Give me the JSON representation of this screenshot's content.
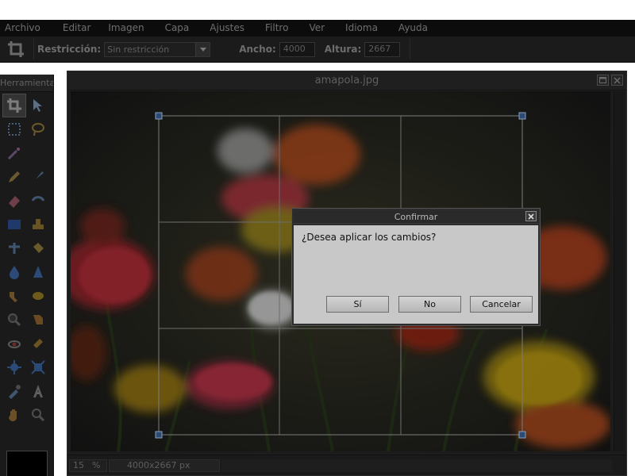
{
  "menu": [
    "Archivo",
    "Editar",
    "Imagen",
    "Capa",
    "Ajustes",
    "Filtro",
    "Ver",
    "Idioma",
    "Ayuda"
  ],
  "options": {
    "tool_icon": "crop-icon",
    "restriction_label": "Restricción:",
    "restriction_value": "Sin restricción",
    "width_label": "Ancho:",
    "width_value": "4000",
    "height_label": "Altura:",
    "height_value": "2667"
  },
  "toolbox": {
    "title": "Herramientas",
    "tools": [
      {
        "icon": "crop-icon",
        "active": true
      },
      {
        "icon": "move-icon"
      },
      {
        "icon": "marquee-icon"
      },
      {
        "icon": "lasso-icon"
      },
      {
        "icon": "magic-wand-icon"
      },
      {
        "icon": "pencil-icon"
      },
      {
        "icon": "brush-icon"
      },
      {
        "icon": "eraser-icon"
      },
      {
        "icon": "replace-color-icon"
      },
      {
        "icon": "gradient-icon"
      },
      {
        "icon": "stamp-icon"
      },
      {
        "icon": "color-picker-icon"
      },
      {
        "icon": "paint-bucket-icon"
      },
      {
        "icon": "drop-icon"
      },
      {
        "icon": "sharpen-icon"
      },
      {
        "icon": "smudge-icon"
      },
      {
        "icon": "sponge-icon"
      },
      {
        "icon": "zoom-icon"
      },
      {
        "icon": "burn-icon"
      },
      {
        "icon": "red-eye-icon"
      },
      {
        "icon": "bandage-icon"
      },
      {
        "icon": "pinch-icon"
      },
      {
        "icon": "bloat-icon"
      },
      {
        "icon": "eyedropper-icon"
      },
      {
        "icon": "text-icon"
      },
      {
        "icon": "hand-icon"
      },
      {
        "icon": "magnifier-icon"
      }
    ],
    "foreground_color": "#000000"
  },
  "document": {
    "title": "amapola.jpg",
    "zoom": "15",
    "zoom_unit": "%",
    "size": "4000x2667 px"
  },
  "dialog": {
    "title": "Confirmar",
    "message": "¿Desea aplicar los cambios?",
    "yes": "Sí",
    "no": "No",
    "cancel": "Cancelar"
  },
  "colors": {
    "handle": "#2b4b74",
    "dialog_body": "#c8c8c8"
  }
}
